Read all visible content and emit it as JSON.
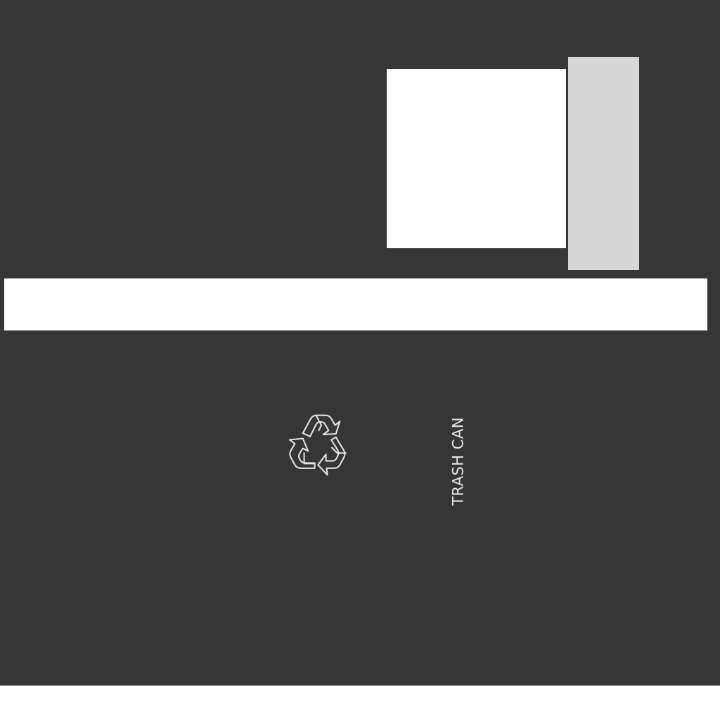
{
  "label": {
    "text": "TRASH CAN"
  },
  "icons": {
    "recycle": "recycle-icon"
  },
  "colors": {
    "background": "#363636",
    "panel_white": "#ffffff",
    "panel_gray": "#d7d7d7",
    "label": "#e4e4e4"
  }
}
